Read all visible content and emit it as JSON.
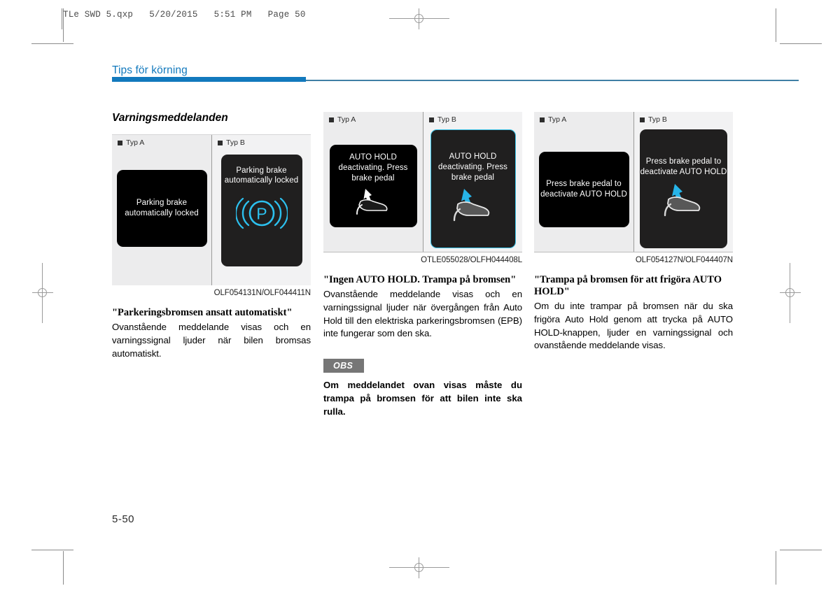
{
  "print_marks": {
    "file_header": "TLe SWD 5.qxp   5/20/2015   5:51 PM   Page 50"
  },
  "header": {
    "chapter_title": "Tips för körning",
    "accent_color": "#1279bd"
  },
  "main": {
    "section_title": "Varningsmeddelanden",
    "columns": [
      {
        "figure": {
          "panel_a_label": "Typ A",
          "panel_b_label": "Typ B",
          "screen_a_text": "Parking brake automatically locked",
          "screen_b_text": "Parking brake automatically locked",
          "screen_b_icon": "parking-brake-p-icon",
          "caption": "OLF054131N/OLF044411N"
        },
        "heading": "\"Parkeringsbromsen ansatt automatiskt\"",
        "body": "Ovanstående meddelande visas och en varningssignal ljuder när bilen bromsas automatiskt."
      },
      {
        "figure": {
          "panel_a_label": "Typ A",
          "panel_b_label": "Typ B",
          "screen_a_text": "AUTO HOLD deactivating. Press brake pedal",
          "screen_b_text": "AUTO HOLD deactivating. Press brake pedal",
          "screen_a_icon": "brake-pedal-foot-icon",
          "screen_b_icon": "brake-pedal-foot-icon",
          "caption": "OTLE055028/OLFH044408L"
        },
        "heading": "\"Ingen AUTO HOLD. Trampa på bromsen\"",
        "body": "Ovanstående meddelande visas och en varningssignal ljuder när övergången från Auto Hold till den elektriska parkeringsbromsen (EPB) inte fungerar som den ska.",
        "note": {
          "badge": "OBS",
          "text": "Om meddelandet ovan visas måste du trampa på bromsen för att bilen inte ska rulla."
        }
      },
      {
        "figure": {
          "panel_a_label": "Typ A",
          "panel_b_label": "Typ B",
          "screen_a_text": "Press brake pedal to deactivate AUTO HOLD",
          "screen_b_text": "Press brake pedal to deactivate AUTO HOLD",
          "screen_b_icon": "brake-pedal-foot-icon",
          "caption": "OLF054127N/OLF044407N"
        },
        "heading": "\"Trampa på bromsen för att frigöra AUTO HOLD\"",
        "body": "Om du inte trampar på bromsen när du ska frigöra Auto Hold genom att trycka på AUTO HOLD-knappen, ljuder en varningssignal och ovanstående meddelande visas."
      }
    ]
  },
  "footer": {
    "page_number": "5-50"
  }
}
